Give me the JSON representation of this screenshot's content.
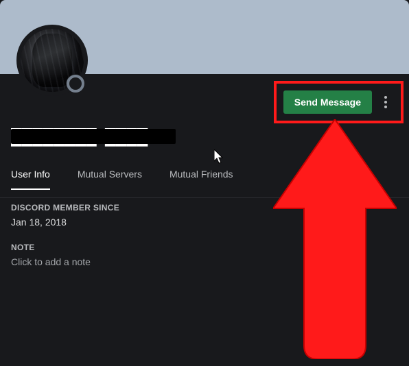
{
  "profile": {
    "username_redacted": true,
    "status": "offline"
  },
  "actions": {
    "send_message_label": "Send Message"
  },
  "tabs": {
    "user_info": "User Info",
    "mutual_servers": "Mutual Servers",
    "mutual_friends": "Mutual Friends",
    "active": "user_info"
  },
  "user_info": {
    "member_since_label": "DISCORD MEMBER SINCE",
    "member_since_value": "Jan 18, 2018",
    "note_label": "NOTE",
    "note_placeholder": "Click to add a note"
  },
  "annotation": {
    "highlight_color": "#ff1a1a"
  }
}
